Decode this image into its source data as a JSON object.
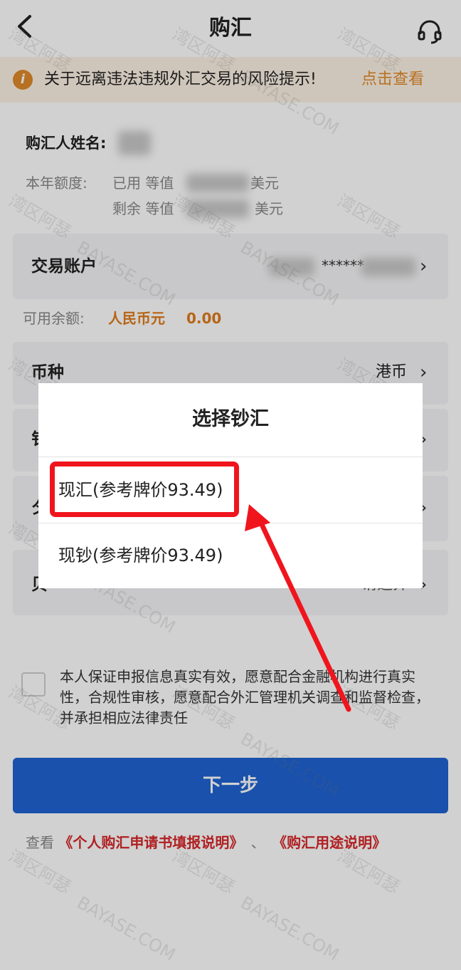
{
  "header": {
    "title": "购汇",
    "back_icon": "chevron-left-icon",
    "service_icon": "headset-icon"
  },
  "notice": {
    "icon": "info-icon",
    "icon_glyph": "i",
    "text": "关于远离违法违规外汇交易的风险提示!",
    "link": "点击查看"
  },
  "buyer": {
    "label": "购汇人姓名:"
  },
  "quota": {
    "label": "本年额度:",
    "used_prefix": "已用 等值",
    "used_unit": "美元",
    "remaining_prefix": "剩余 等值",
    "remaining_unit": "美元"
  },
  "account": {
    "label": "交易账户",
    "masked": "******",
    "chevron": "›"
  },
  "balance": {
    "label": "可用余额:",
    "currency": "人民币元",
    "amount": "0.00"
  },
  "currency_row": {
    "label": "币种",
    "value": "港币",
    "chevron": "›"
  },
  "partial_rows": [
    {
      "fragment": "钅",
      "chevron": "›"
    },
    {
      "fragment": "夕",
      "chevron": "›"
    },
    {
      "fragment": "贝",
      "value_fragment": "请选择",
      "chevron": "›"
    }
  ],
  "agreement": {
    "text": "本人保证申报信息真实有效，愿意配合金融机构进行真实性，合规性审核，愿意配合外汇管理机关调查和监督检查，并承担相应法律责任"
  },
  "next_button": "下一步",
  "links": {
    "prefix": "查看",
    "link1": "《个人购汇申请书填报说明》",
    "separator": "、",
    "link2": "《购汇用途说明》"
  },
  "modal": {
    "title": "选择钞汇",
    "options": [
      "现汇(参考牌价93.49)",
      "现钞(参考牌价93.49)"
    ]
  },
  "watermark": "湾区阿瑟",
  "watermark_en": "BAYASE.COM",
  "colors": {
    "primary": "#1f63d2",
    "accent_orange": "#e07b1a",
    "link_red": "#d7282a",
    "highlight_red": "#f0151d"
  }
}
